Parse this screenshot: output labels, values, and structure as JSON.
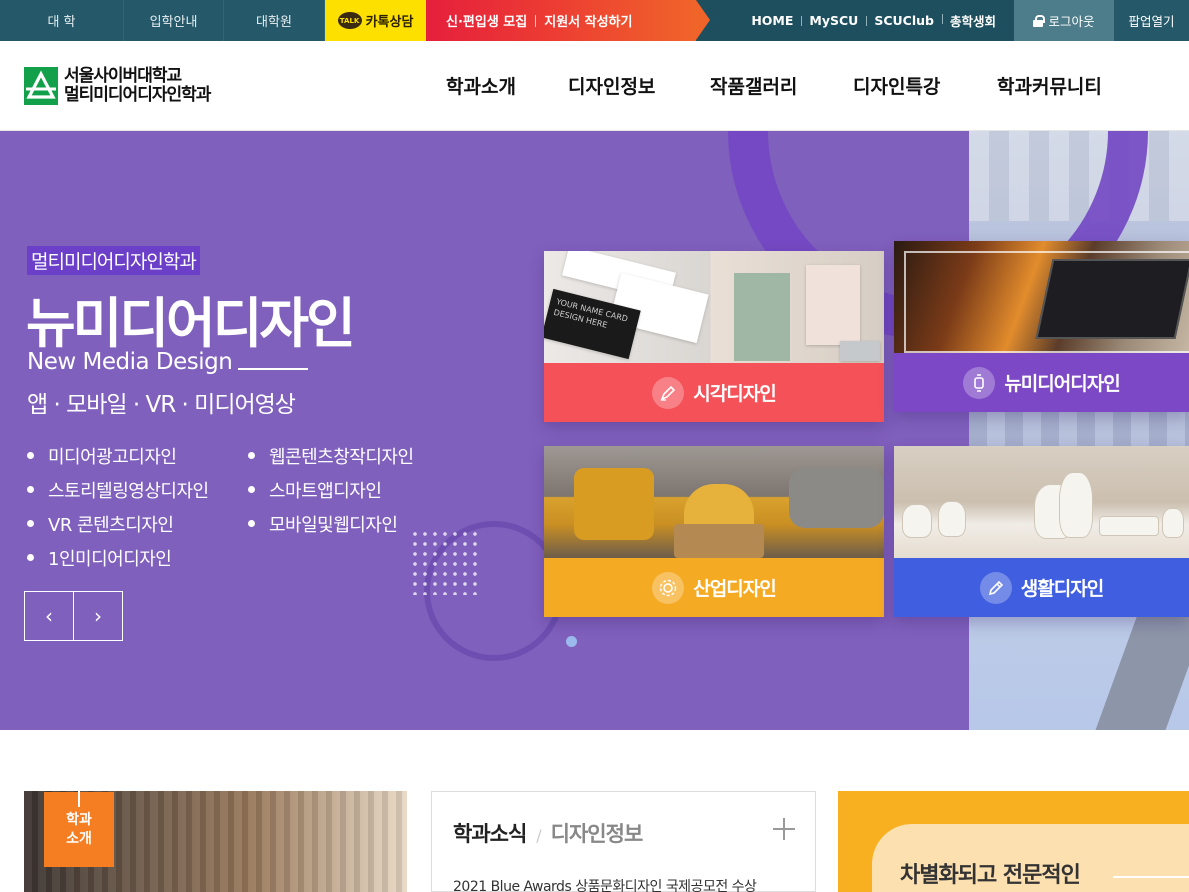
{
  "topbar": {
    "tabs": [
      "대 학",
      "입학안내",
      "대학원"
    ],
    "kakao_icon_text": "TALK",
    "kakao_label": "카톡상담",
    "promo_1": "신·편입생 모집",
    "promo_2": "지원서 작성하기",
    "links": [
      "HOME",
      "MySCU",
      "SCUClub",
      "총학생회"
    ],
    "logout": "로그아웃",
    "popup": "팝업열기"
  },
  "header": {
    "logo_line1": "서울사이버대학교",
    "logo_line2": "멀티미디어디자인학과",
    "nav": [
      "학과소개",
      "디자인정보",
      "작품갤러리",
      "디자인특강",
      "학과커뮤니티"
    ]
  },
  "hero": {
    "tag": "멀티미디어디자인학과",
    "title": "뉴미디어디자인",
    "subtitle_en": "New Media Design",
    "subtitle_kr": "앱 · 모바일 · VR · 미디어영상",
    "list": [
      "미디어광고디자인",
      "웹콘텐츠창작디자인",
      "스토리텔링영상디자인",
      "스마트앱디자인",
      "VR 콘텐츠디자인",
      "모바일및웹디자인",
      "1인미디어디자인"
    ],
    "prev": "‹",
    "next": "›",
    "cards": [
      {
        "label": "시각디자인",
        "color": "#f45158",
        "icon": "pen-icon"
      },
      {
        "label": "뉴미디어디자인",
        "color": "#7c48c6",
        "icon": "smartwatch-icon"
      },
      {
        "label": "산업디자인",
        "color": "#f5aa24",
        "icon": "gear-icon"
      },
      {
        "label": "생활디자인",
        "color": "#3f5fe0",
        "icon": "pencil-icon"
      }
    ],
    "bizcard_text": "YOUR NAME CARD DESIGN HERE"
  },
  "lower": {
    "intro_badge_1": "학과",
    "intro_badge_2": "소개",
    "news_tab_active": "학과소식",
    "news_slash": "/",
    "news_tab_inactive": "디자인정보",
    "news_item": "2021 Blue Awards 상품문화디자인 국제공모전 수상",
    "feature_title": "차별화되고 전문적인"
  },
  "colors": {
    "topbar": "#1d4f5e",
    "hero_bg": "#8060bd",
    "kakao": "#fde000",
    "promo": "#e51f3c",
    "logo_green": "#12a14a"
  }
}
